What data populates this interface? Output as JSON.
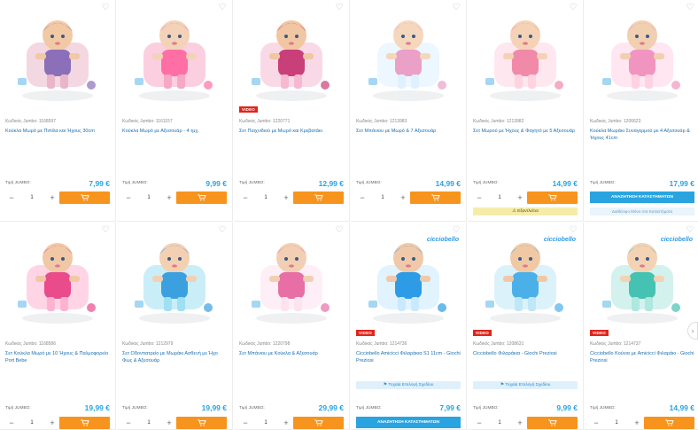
{
  "product_code_label": "Κωδικός Jumbo:",
  "price_label": "Τιμή JUMBO:",
  "video_badge": "VIDEO",
  "products_row1": [
    {
      "code": "1168597",
      "name": "Κούκλα Μωρό με Πιπίλα και Ήχους 30cm",
      "price": "7,99 €"
    },
    {
      "code": "1161157",
      "name": "Κούκλα Μωρό με Αξεσουάρ - 4 τμχ.",
      "price": "9,99 €"
    },
    {
      "code": "1220771",
      "name": "Σετ Παιχνιδιού με Μωρό και Κρεβατάκι",
      "price": "12,99 €",
      "video": true
    },
    {
      "code": "1213983",
      "name": "Σετ Μπάνιου με Μωρό & 7 Αξεσουάρ",
      "price": "14,99 €"
    },
    {
      "code": "1213982",
      "name": "Σετ Μωρού με Ήχους & Φαγητό με 5 Αξεσουάρ",
      "price": "14,99 €",
      "availability": "Εξαντλείται"
    },
    {
      "code": "1206623",
      "name": "Κούκλα Μωράκι Συναγερμού με 4 Αξεσουάρ & Ήχους 41cm",
      "price": "17,99 €",
      "store_button": "ΑΝΑΖΗΤΗΣΗ ΚΑΤΑΣΤΗΜΑΤΩΝ",
      "store_note": "Διαθέσιμο Μόνο στα Καταστήματα"
    }
  ],
  "products_row2": [
    {
      "code": "1168586",
      "name": "Σετ Κούκλα Μωρό με 10 Ήχους & Παλμοφορείο Port Bebe",
      "price": "19,99 €"
    },
    {
      "code": "1212979",
      "name": "Σετ Οδοντιατρείο με Μωράκι Ασθενή με Ήχο Φως & Αξεσουάρ",
      "price": "19,99 €"
    },
    {
      "code": "1220798",
      "name": "Σετ Μπάνιου με Κούκλα & Αξεσουάρ",
      "price": "29,99 €"
    },
    {
      "code": "1214736",
      "name": "Cicciobello Amicicci Φιλαράκια S1 11cm - Giochi Preziosi",
      "price": "7,99 €",
      "video": true,
      "info": "Τυχαία Επιλογή Σχεδίου",
      "store_button": "ΑΝΑΖΗΤΗΣΗ ΚΑΤΑΣΤΗΜΑΤΩΝ",
      "brand": "cicciobello"
    },
    {
      "code": "1208631",
      "name": "Cicciobello Φιλαράκια - Giochi Preziosi",
      "price": "9,99 €",
      "video": true,
      "info": "Τυχαία Επιλογή Σχεδίου",
      "brand": "cicciobello"
    },
    {
      "code": "1214737",
      "name": "Cicciobello Κούνια με Amicicci Φιλαράκι - Giochi Preziosi",
      "price": "14,99 €",
      "video": true,
      "brand": "cicciobello"
    }
  ],
  "qty_default": "1",
  "colors": {
    "price": "#29a4e0",
    "cart": "#f7941d",
    "link": "#1a6fb0",
    "video": "#e0251b"
  }
}
